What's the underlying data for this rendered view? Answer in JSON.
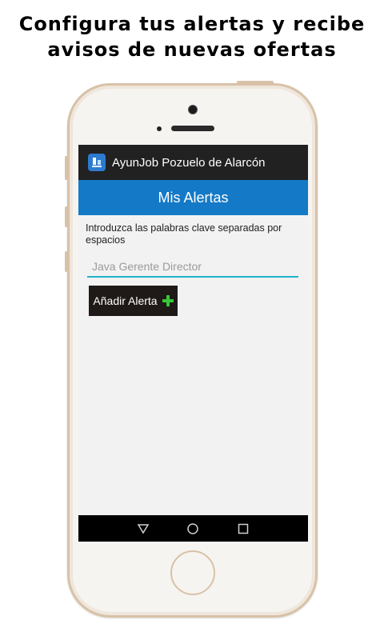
{
  "promo": {
    "line1": "Configura tus alertas y recibe",
    "line2": "avisos de nuevas ofertas"
  },
  "app": {
    "title": "AyunJob Pozuelo de Alarcón",
    "icon": "app-logo-icon"
  },
  "section": {
    "title": "Mis Alertas"
  },
  "form": {
    "instructions": "Introduzca las palabras clave separadas por espacios",
    "keywords_placeholder": "Java Gerente Director",
    "keywords_value": "",
    "add_button_label": "Añadir Alerta",
    "add_button_icon": "plus-icon"
  },
  "navbar": {
    "icons": [
      "back-icon",
      "home-icon",
      "recents-icon"
    ]
  },
  "colors": {
    "header_blue": "#1479c6",
    "titlebar": "#212121",
    "input_underline": "#1fb3c9",
    "plus_green": "#39c43a",
    "phone_frame": "#d8c2a7"
  }
}
